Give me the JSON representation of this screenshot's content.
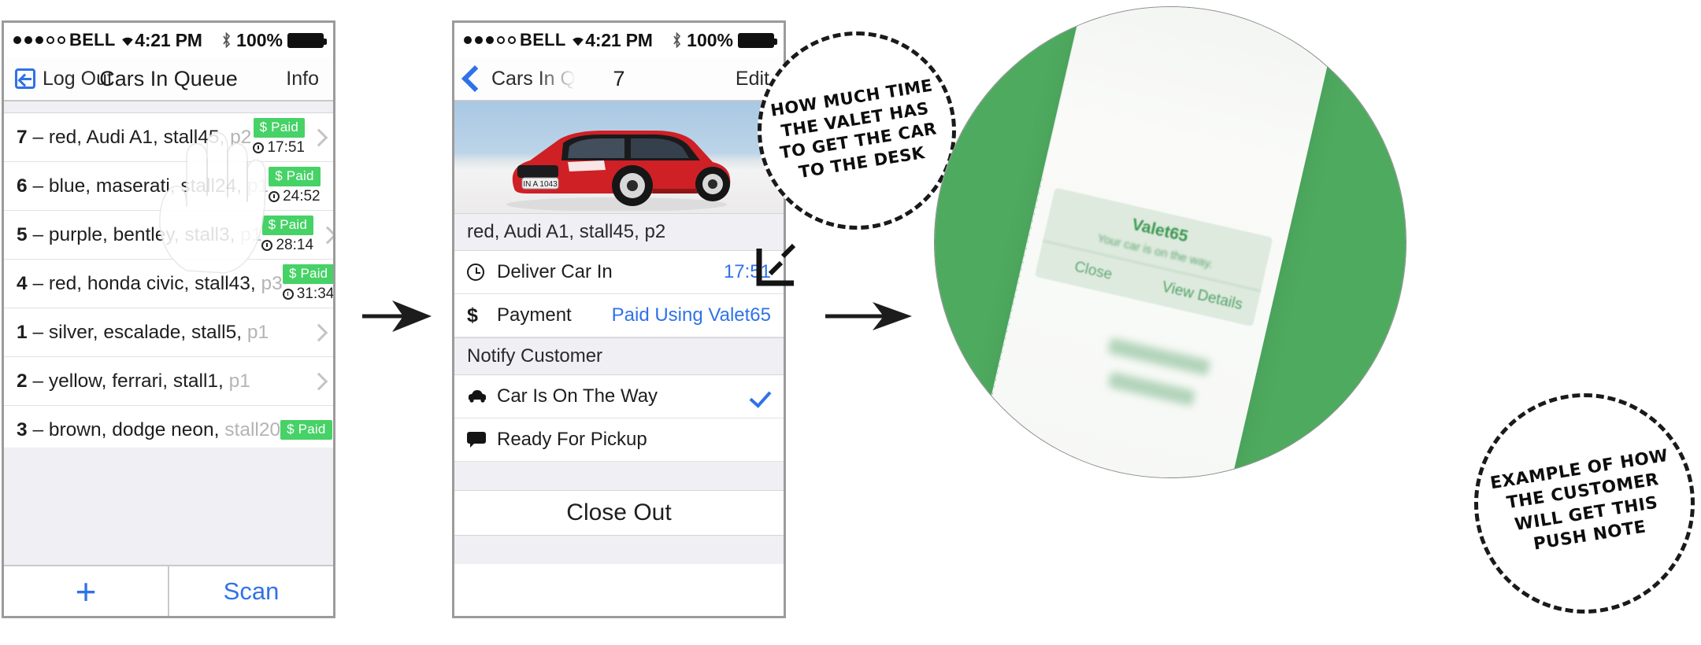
{
  "phone1": {
    "statusbar": {
      "carrier": "BELL",
      "time": "4:21 PM",
      "battery_pct": "100%",
      "wifi_icon": "wifi-icon",
      "bluetooth_icon": "bluetooth-icon",
      "battery_icon": "battery-icon",
      "signal_icon": "signal-dots-icon"
    },
    "navbar": {
      "back_label": "Log Out",
      "back_icon": "logout-icon",
      "title": "Cars In Queue",
      "right_label": "Info"
    },
    "rows": [
      {
        "num": "7",
        "desc": "red, Audi A1, stall45,",
        "dim": "p2",
        "paid": "$ Paid",
        "timer": "17:51",
        "chevron_icon": "chevron-right-icon"
      },
      {
        "num": "6",
        "desc": "blue, maserati, stall24,",
        "dim": "p1",
        "paid": "$ Paid",
        "timer": "24:52",
        "chevron_icon": "chevron-right-icon"
      },
      {
        "num": "5",
        "desc": "purple, bentley, stall3,",
        "dim": "p1",
        "paid": "$ Paid",
        "timer": "28:14",
        "chevron_icon": "chevron-right-icon"
      },
      {
        "num": "4",
        "desc": "red, honda civic, stall43,",
        "dim": "p3",
        "paid": "$ Paid",
        "timer": "31:34",
        "chevron_icon": "chevron-right-icon"
      },
      {
        "num": "1",
        "desc": "silver, escalade, stall5,",
        "dim": "p1",
        "paid": "",
        "timer": "",
        "chevron_icon": "chevron-right-icon"
      },
      {
        "num": "2",
        "desc": "yellow, ferrari, stall1,",
        "dim": "p1",
        "paid": "",
        "timer": "",
        "chevron_icon": "chevron-right-icon"
      },
      {
        "num": "3",
        "desc": "brown, dodge neon,",
        "dim": "stall20",
        "paid": "$ Paid",
        "timer": "",
        "chevron_icon": "chevron-right-icon"
      }
    ],
    "toolbar": {
      "add_label": "+",
      "scan_label": "Scan"
    }
  },
  "phone2": {
    "statusbar": {
      "carrier": "BELL",
      "time": "4:21 PM",
      "battery_pct": "100%"
    },
    "navbar": {
      "back_label": "Cars In Q",
      "back_icon": "chevron-left-icon",
      "title": "7",
      "right_label": "Edit"
    },
    "photo": {
      "alt_name": "red-audi-a1-photo",
      "plate": "IN A 1043"
    },
    "car_header": "red, Audi A1, stall45, p2",
    "detail_rows": [
      {
        "icon": "clock-icon",
        "label": "Deliver Car In",
        "value": "17:51"
      },
      {
        "icon": "dollar-icon",
        "label": "Payment",
        "value": "Paid Using Valet65"
      }
    ],
    "notify_section_title": "Notify Customer",
    "notify_rows": [
      {
        "icon": "car-icon",
        "label": "Car Is On The Way",
        "checked": true,
        "check_icon": "checkmark-icon"
      },
      {
        "icon": "message-icon",
        "label": "Ready For Pickup",
        "checked": false,
        "check_icon": ""
      }
    ],
    "close_out_label": "Close Out"
  },
  "annotations": {
    "bubble1": {
      "lines": [
        "HOW MUCH TIME",
        "THE VALET HAS",
        "TO GET THE CAR",
        "TO THE DESK"
      ]
    },
    "bubble2": {
      "lines": [
        "EXAMPLE OF HOW",
        "THE CUSTOMER",
        "WILL GET THIS",
        "PUSH NOTE"
      ]
    },
    "arrow1_name": "flow-arrow-1",
    "arrow2_name": "flow-arrow-2"
  },
  "photo_circle": {
    "notification": {
      "app_title": "Valet65",
      "body": "Your car is on the way.",
      "close_label": "Close",
      "details_label": "View Details"
    }
  },
  "colors": {
    "paid_green": "#46d266",
    "link_blue": "#2f72e8",
    "halftone_green": "#4eaa5f",
    "ios_group_bg": "#efeff4"
  }
}
